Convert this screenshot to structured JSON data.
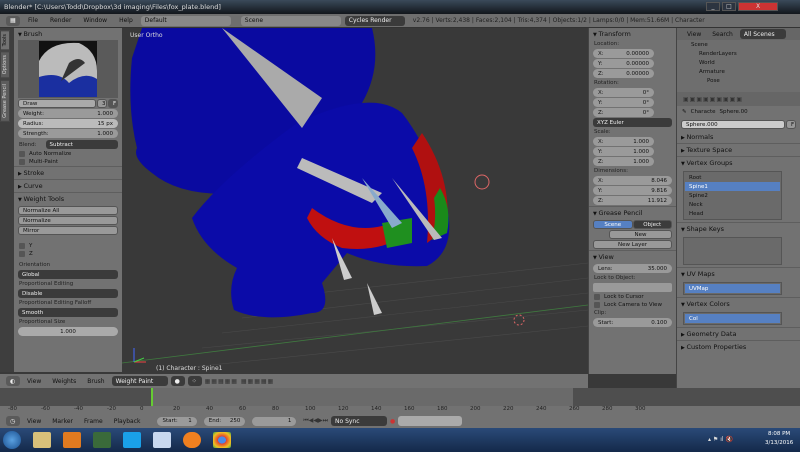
{
  "window": {
    "title": "Blender* [C:\\Users\\Todd\\Dropbox\\3d imaging\\Files\\fox_plate.blend]",
    "min": "_",
    "max": "□",
    "close": "X"
  },
  "topbar": {
    "menus": [
      "File",
      "Render",
      "Window",
      "Help"
    ],
    "layout": "Default",
    "scene": "Scene",
    "engine": "Cycles Render",
    "stats": "v2.76 | Verts:2,438 | Faces:2,104 | Tris:4,374 | Objects:1/2 | Lamps:0/0 | Mem:51.66M | Character"
  },
  "tool_tabs": [
    "Tools",
    "Options",
    "Grease Pencil"
  ],
  "tools": {
    "brush_header": "Brush",
    "brush_name": "Draw",
    "brush_users": "3",
    "brush_fake": "F",
    "weight_label": "Weight:",
    "weight": "1.000",
    "radius_label": "Radius:",
    "radius": "15 px",
    "strength_label": "Strength:",
    "strength": "1.000",
    "blend_label": "Blend:",
    "blend": "Subtract",
    "auto_normalize": "Auto Normalize",
    "multi_paint": "Multi-Paint",
    "stroke": "Stroke",
    "curve": "Curve",
    "weight_tools": "Weight Tools",
    "wt_buttons": [
      "Normalize All",
      "Normalize",
      "Mirror"
    ],
    "y": "Y",
    "z": "Z",
    "orientation_label": "Orientation",
    "orientation": "Global",
    "prop_edit_label": "Proportional Editing",
    "prop_edit": "Disable",
    "falloff_label": "Proportional Editing Falloff",
    "falloff": "Smooth",
    "prop_size_label": "Proportional Size",
    "prop_size": "1.000"
  },
  "viewport": {
    "view_name": "User Ortho",
    "object_info": "(1) Character : Spine1"
  },
  "view_header": {
    "menus": [
      "View",
      "Weights",
      "Brush"
    ],
    "mode": "Weight Paint"
  },
  "npanel": {
    "transform": "Transform",
    "location": "Location:",
    "loc": [
      [
        "X:",
        "0.00000"
      ],
      [
        "Y:",
        "0.00000"
      ],
      [
        "Z:",
        "0.00000"
      ]
    ],
    "rotation": "Rotation:",
    "rot": [
      [
        "X:",
        "0°"
      ],
      [
        "Y:",
        "0°"
      ],
      [
        "Z:",
        "0°"
      ]
    ],
    "rot_mode": "XYZ Euler",
    "scale": "Scale:",
    "scl": [
      [
        "X:",
        "1.000"
      ],
      [
        "Y:",
        "1.000"
      ],
      [
        "Z:",
        "1.000"
      ]
    ],
    "dimensions": "Dimensions:",
    "dim": [
      [
        "X:",
        "8.046"
      ],
      [
        "Y:",
        "9.816"
      ],
      [
        "Z:",
        "11.912"
      ]
    ],
    "grease_pencil": "Grease Pencil",
    "gp_scene": "Scene",
    "gp_object": "Object",
    "gp_new": "New",
    "gp_new_layer": "New Layer",
    "view": "View",
    "lens_label": "Lens:",
    "lens": "35.000",
    "lock_object": "Lock to Object:",
    "lock_cursor": "Lock to Cursor",
    "lock_camera": "Lock Camera to View",
    "clip": "Clip:",
    "start_label": "Start:",
    "start": "0.100"
  },
  "outliner": {
    "menus": [
      "View",
      "Search"
    ],
    "filter": "All Scenes",
    "tree": [
      "Scene",
      "RenderLayers",
      "World",
      "Armature",
      "Pose"
    ]
  },
  "properties": {
    "breadcrumb": [
      "Characte",
      "Sphere.00"
    ],
    "mesh_name": "Sphere.000",
    "mesh_f": "F",
    "normals": "Normals",
    "texture_space": "Texture Space",
    "vertex_groups": "Vertex Groups",
    "groups": [
      "Root",
      "Spine1",
      "Spine2",
      "Neck",
      "Head"
    ],
    "active_group": 1,
    "shape_keys": "Shape Keys",
    "uv_maps": "UV Maps",
    "uv": "UVMap",
    "vertex_colors": "Vertex Colors",
    "vcol": "Col",
    "geometry_data": "Geometry Data",
    "custom_props": "Custom Properties"
  },
  "timeline": {
    "ticks": [
      "-80",
      "-60",
      "-40",
      "-20",
      "0",
      "20",
      "40",
      "60",
      "80",
      "100",
      "120",
      "140",
      "160",
      "180",
      "200",
      "220",
      "240",
      "260",
      "280",
      "300"
    ],
    "menus": [
      "View",
      "Marker",
      "Frame",
      "Playback"
    ],
    "start_label": "Start:",
    "start": "1",
    "end_label": "End:",
    "end": "250",
    "current": "1",
    "sync": "No Sync"
  },
  "taskbar": {
    "time": "8:08 PM",
    "date": "3/13/2016"
  },
  "colors": {
    "viewport": "#393939",
    "panel": "#727272",
    "accent": "#5680c2",
    "mesh": "#0a0a9c"
  }
}
